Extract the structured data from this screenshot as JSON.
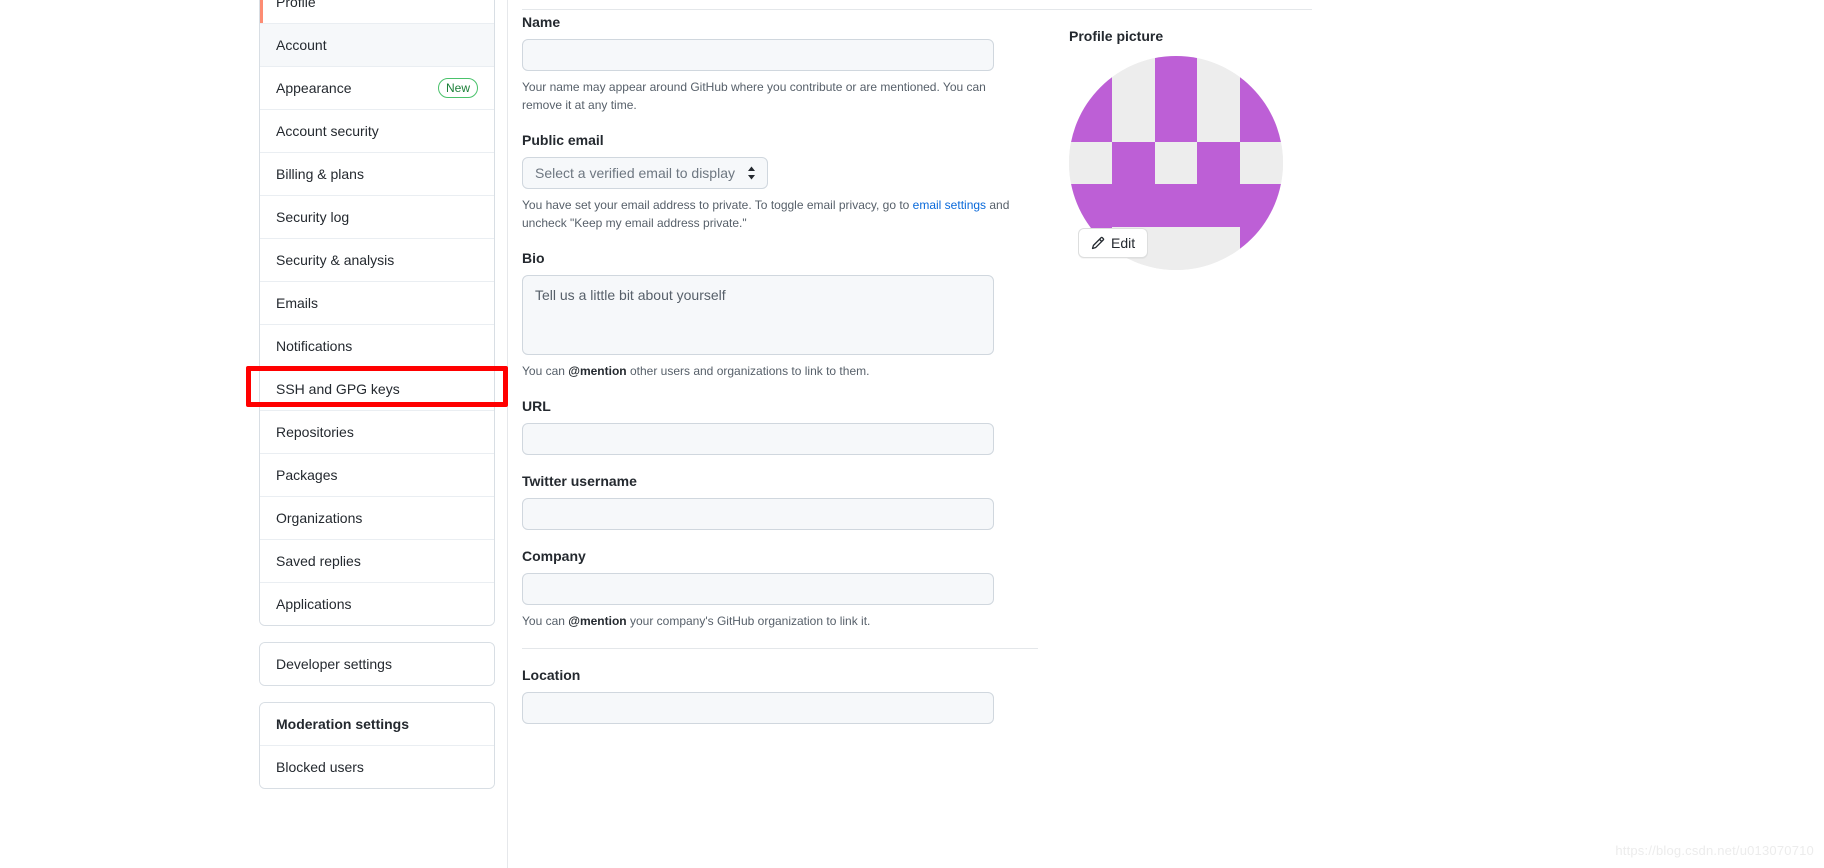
{
  "sidebar": {
    "groups": [
      {
        "name": "personal-settings",
        "items": [
          {
            "label": "Profile",
            "state": "selected",
            "badge": null
          },
          {
            "label": "Account",
            "state": "hovered",
            "badge": null
          },
          {
            "label": "Appearance",
            "state": "normal",
            "badge": "New"
          },
          {
            "label": "Account security",
            "state": "normal",
            "badge": null
          },
          {
            "label": "Billing & plans",
            "state": "normal",
            "badge": null
          },
          {
            "label": "Security log",
            "state": "normal",
            "badge": null
          },
          {
            "label": "Security & analysis",
            "state": "normal",
            "badge": null
          },
          {
            "label": "Emails",
            "state": "normal",
            "badge": null
          },
          {
            "label": "Notifications",
            "state": "normal",
            "badge": null
          },
          {
            "label": "SSH and GPG keys",
            "state": "normal",
            "badge": null
          },
          {
            "label": "Repositories",
            "state": "normal",
            "badge": null
          },
          {
            "label": "Packages",
            "state": "normal",
            "badge": null
          },
          {
            "label": "Organizations",
            "state": "normal",
            "badge": null
          },
          {
            "label": "Saved replies",
            "state": "normal",
            "badge": null
          },
          {
            "label": "Applications",
            "state": "normal",
            "badge": null
          }
        ]
      },
      {
        "name": "developer-settings",
        "items": [
          {
            "label": "Developer settings",
            "state": "normal",
            "badge": null
          }
        ]
      },
      {
        "name": "moderation-settings",
        "items": [
          {
            "label": "Moderation settings",
            "state": "header",
            "badge": null
          },
          {
            "label": "Blocked users",
            "state": "normal",
            "badge": null
          }
        ]
      }
    ]
  },
  "main": {
    "name": {
      "label": "Name",
      "value": "",
      "placeholder": "",
      "help_prefix": "Your name may appear around GitHub where you contribute or are mentioned. You can remove it at any time."
    },
    "public_email": {
      "label": "Public email",
      "selected_option": "Select a verified email to display",
      "help_before": "You have set your email address to private. To toggle email privacy, go to ",
      "help_link": "email settings",
      "help_after": " and uncheck \"Keep my email address private.\""
    },
    "bio": {
      "label": "Bio",
      "value": "",
      "placeholder": "Tell us a little bit about yourself",
      "help_before": "You can ",
      "help_bold": "@mention",
      "help_after": " other users and organizations to link to them."
    },
    "url": {
      "label": "URL",
      "value": "",
      "placeholder": ""
    },
    "twitter": {
      "label": "Twitter username",
      "value": "",
      "placeholder": ""
    },
    "company": {
      "label": "Company",
      "value": "",
      "placeholder": "",
      "help_before": "You can ",
      "help_bold": "@mention",
      "help_after": " your company's GitHub organization to link it."
    },
    "location": {
      "label": "Location",
      "value": "",
      "placeholder": ""
    }
  },
  "profile_picture": {
    "title": "Profile picture",
    "edit_label": "Edit",
    "edit_icon": "pencil-icon",
    "identicon": {
      "fg_color": "#bd5fd6",
      "bg_color": "#ededed",
      "grid": [
        [
          1,
          0,
          1,
          0,
          1
        ],
        [
          1,
          0,
          1,
          0,
          1
        ],
        [
          0,
          1,
          0,
          1,
          0
        ],
        [
          1,
          1,
          1,
          1,
          1
        ],
        [
          1,
          0,
          0,
          0,
          1
        ]
      ]
    }
  },
  "annotation": {
    "target_label": "SSH and GPG keys",
    "color": "#ff0000"
  },
  "watermark": {
    "text": "https://blog.csdn.net/u013070710"
  }
}
